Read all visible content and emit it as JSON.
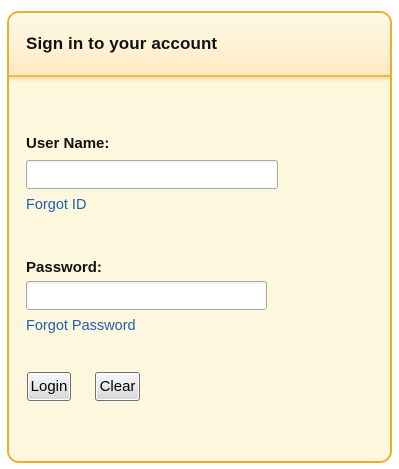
{
  "panel": {
    "title": "Sign in to your account"
  },
  "username": {
    "label": "User Name:",
    "value": "",
    "forgot_link": "Forgot ID"
  },
  "password": {
    "label": "Password:",
    "value": "",
    "forgot_link": "Forgot Password"
  },
  "buttons": {
    "login": "Login",
    "clear": "Clear"
  },
  "colors": {
    "accent_border": "#f0ad2b",
    "panel_background": "#fdf7dd",
    "link": "#1f5fb3"
  }
}
